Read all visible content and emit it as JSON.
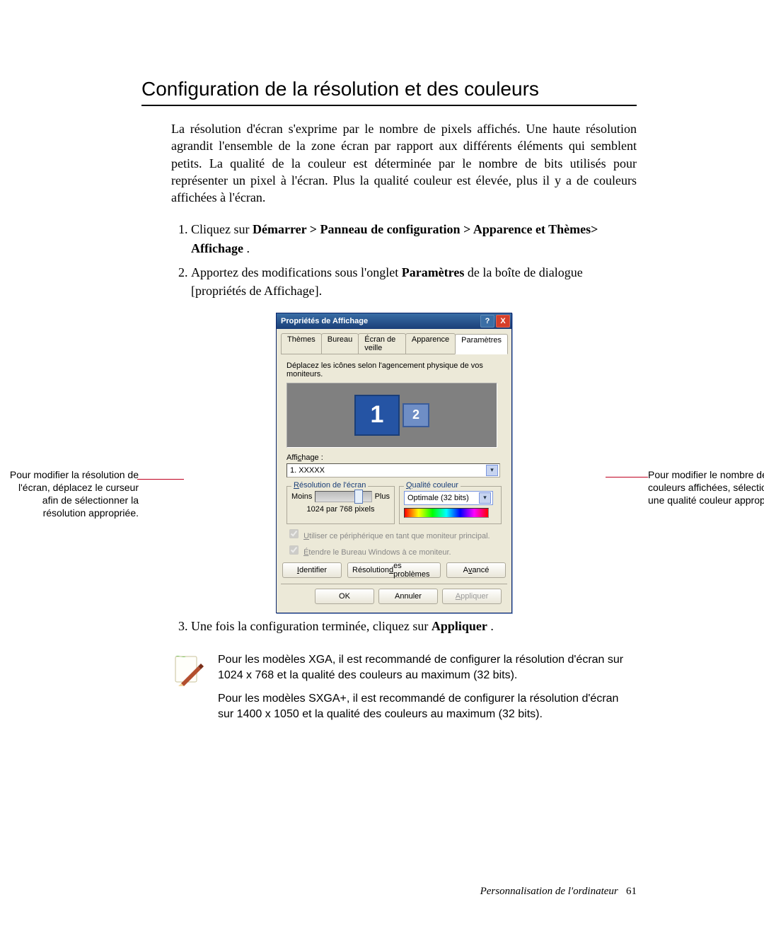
{
  "title": "Configuration de la résolution et des couleurs",
  "intro": "La résolution d'écran s'exprime par le nombre de pixels affichés. Une haute résolution agrandit l'ensemble de la zone écran par rapport aux différents éléments qui semblent petits. La qualité de la couleur est déterminée par le nombre de bits utilisés pour représenter un pixel à l'écran. Plus la qualité couleur est élevée, plus il y a de couleurs affichées à l'écran.",
  "steps": {
    "s1_prefix": "Cliquez sur ",
    "s1_bold": "Démarrer > Panneau de configuration > Apparence et Thèmes> Affichage",
    "s1_suffix": ".",
    "s2_prefix": "Apportez des modifications sous l'onglet ",
    "s2_bold": "Paramètres",
    "s2_suffix": " de la boîte de dialogue [propriétés de Affichage].",
    "s3_prefix": "Une fois la configuration terminée, cliquez sur ",
    "s3_bold": "Appliquer",
    "s3_suffix": "."
  },
  "dialog": {
    "title": "Propriétés de Affichage",
    "help_glyph": "?",
    "close_glyph": "X",
    "tabs": [
      "Thèmes",
      "Bureau",
      "Écran de veille",
      "Apparence",
      "Paramètres"
    ],
    "hint": "Déplacez les icônes selon l'agencement physique de vos moniteurs.",
    "monitor1": "1",
    "monitor2": "2",
    "affichage_label_html": "Affichage :",
    "affichage_under": "c",
    "affichage_value": "1. XXXXX",
    "res_legend_html": "Résolution de l'écran",
    "res_under": "R",
    "moins": "Moins",
    "plus": "Plus",
    "res_value": "1024 par 768 pixels",
    "qual_legend_html": "Qualité couleur",
    "qual_under": "Q",
    "qual_value": "Optimale (32 bits)",
    "chk1_html": "Utiliser ce périphérique en tant que moniteur principal.",
    "chk1_under": "U",
    "chk2_html": "Étendre le Bureau Windows à ce moniteur.",
    "chk2_under": "É",
    "btn_identifier": "Identifier",
    "btn_identifier_under": "I",
    "btn_trouble": "Résolution des problèmes",
    "btn_trouble_under": "d",
    "btn_advanced": "Avancé",
    "btn_advanced_under": "v",
    "btn_ok": "OK",
    "btn_cancel": "Annuler",
    "btn_apply": "Appliquer",
    "btn_apply_under": "A"
  },
  "callouts": {
    "left": "Pour modifier la résolution de l'écran, déplacez le curseur afin de sélectionner la résolution appropriée.",
    "right": "Pour modifier le nombre de couleurs affichées, sélectionnez une qualité couleur appropriée."
  },
  "note": {
    "p1": "Pour les modèles XGA, il est recommandé de configurer la résolution d'écran sur 1024 x 768 et la qualité des couleurs au maximum (32 bits).",
    "p2": "Pour les modèles SXGA+, il est recommandé de configurer la résolution d'écran sur 1400 x 1050 et la qualité des couleurs au maximum (32 bits)."
  },
  "footer": {
    "text": "Personnalisation de l'ordinateur",
    "page": "61"
  }
}
